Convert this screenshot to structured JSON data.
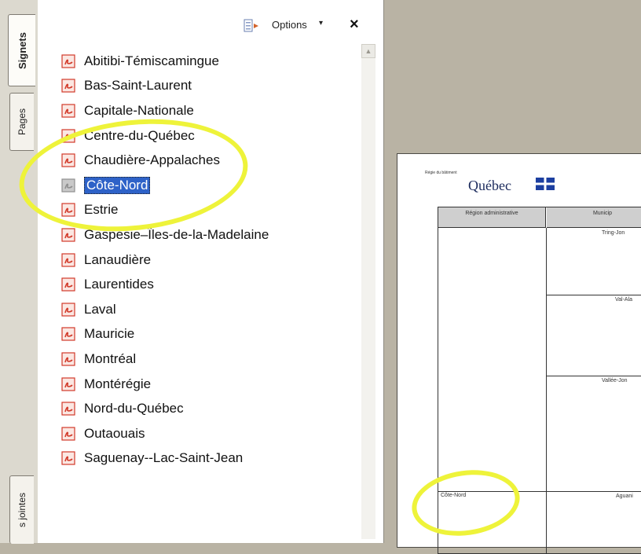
{
  "tabs": {
    "signets": "Signets",
    "pages": "Pages",
    "pieces_jointes": "s jointes"
  },
  "panel": {
    "options_label": "Options",
    "close_label": "×"
  },
  "bookmarks": [
    {
      "label": "Abitibi-Témiscamingue"
    },
    {
      "label": "Bas-Saint-Laurent"
    },
    {
      "label": "Capitale-Nationale"
    },
    {
      "label": "Centre-du-Québec"
    },
    {
      "label": "Chaudière-Appalaches"
    },
    {
      "label": "Côte-Nord",
      "selected": true
    },
    {
      "label": "Estrie"
    },
    {
      "label": "Gaspésie–Îles-de-la-Madelaine"
    },
    {
      "label": "Lanaudière"
    },
    {
      "label": "Laurentides"
    },
    {
      "label": "Laval"
    },
    {
      "label": "Mauricie"
    },
    {
      "label": "Montréal"
    },
    {
      "label": "Montérégie"
    },
    {
      "label": "Nord-du-Québec"
    },
    {
      "label": "Outaouais"
    },
    {
      "label": "Saguenay--Lac-Saint-Jean"
    }
  ],
  "document": {
    "logo_small": "Régie du bâtiment",
    "logo_name": "Québec",
    "header_region": "Région administrative",
    "header_municipality": "Municip",
    "municipalities": [
      "Tring-Jon",
      "Val-Ala",
      "Vallée-Jon",
      "Aguani"
    ],
    "region_label": "Côte-Nord"
  },
  "colors": {
    "selection": "#2e62c8",
    "highlight_circle": "#eef33a",
    "pdf_icon": "#d23a2a"
  }
}
